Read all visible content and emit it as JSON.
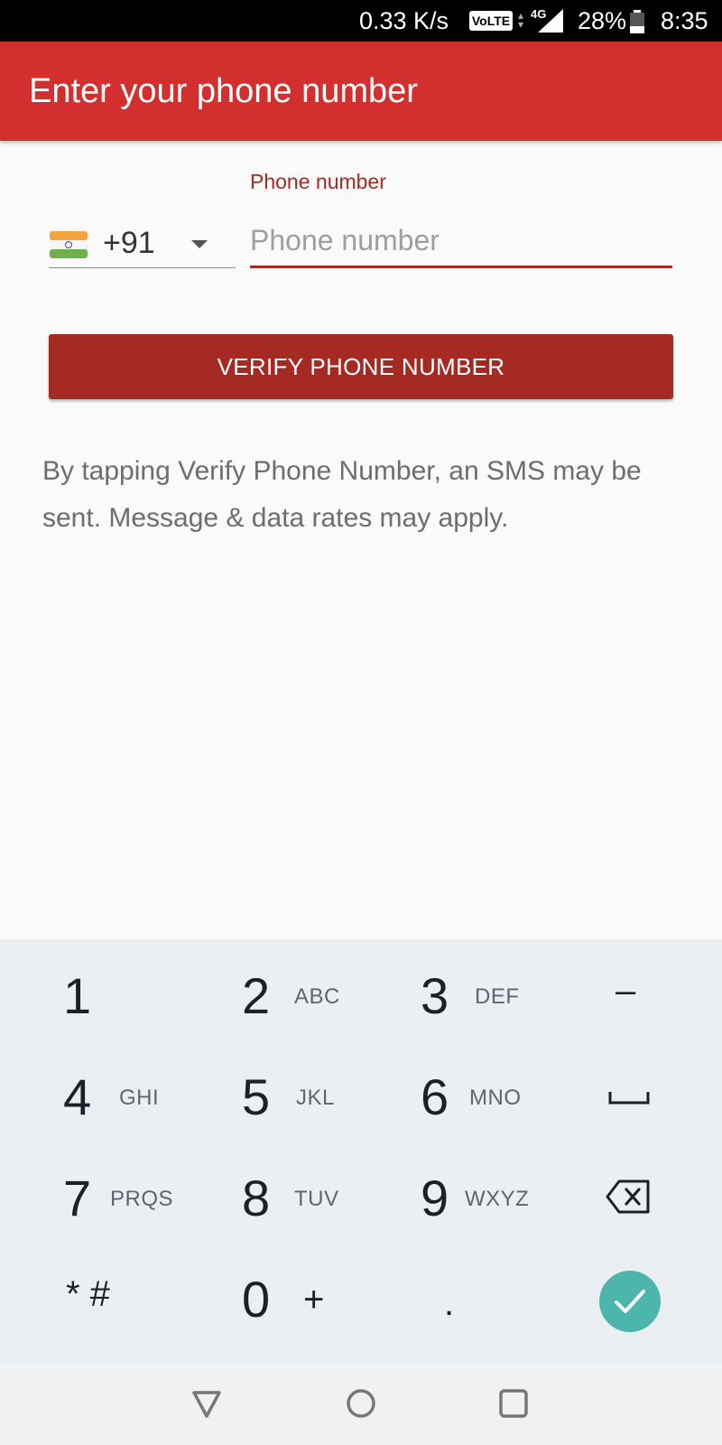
{
  "status_bar": {
    "net_speed": "0.33 K/s",
    "volte_badge": "VoLTE",
    "network_type": "4G",
    "battery_percent": "28%",
    "time": "8:35"
  },
  "app_bar": {
    "title": "Enter your phone number"
  },
  "form": {
    "country_code": "+91",
    "country_flag": "india-flag",
    "phone_label": "Phone number",
    "phone_placeholder": "Phone number",
    "phone_value": "",
    "verify_label": "VERIFY PHONE NUMBER",
    "disclaimer": "By tapping Verify Phone Number, an SMS may be sent. Message & data rates may apply."
  },
  "keypad": {
    "keys": [
      {
        "digit": "1",
        "letters": ""
      },
      {
        "digit": "2",
        "letters": "ABC"
      },
      {
        "digit": "3",
        "letters": "DEF"
      },
      {
        "digit": "4",
        "letters": "GHI"
      },
      {
        "digit": "5",
        "letters": "JKL"
      },
      {
        "digit": "6",
        "letters": "MNO"
      },
      {
        "digit": "7",
        "letters": "PRQS"
      },
      {
        "digit": "8",
        "letters": "TUV"
      },
      {
        "digit": "9",
        "letters": "WXYZ"
      },
      {
        "digit": "0",
        "letters": "+"
      }
    ],
    "star_hash": "* #",
    "dash": "–",
    "period": ".",
    "space_icon": "space-bar-icon",
    "backspace_icon": "backspace-icon",
    "done_icon": "check-icon",
    "done_color": "#4db6ac"
  },
  "nav_bar": {
    "back_icon": "triangle-back-icon",
    "home_icon": "circle-home-icon",
    "recents_icon": "square-recents-icon"
  },
  "colors": {
    "app_bar": "#d32f2f",
    "accent": "#a52a24",
    "keypad_bg": "#eceff2"
  }
}
